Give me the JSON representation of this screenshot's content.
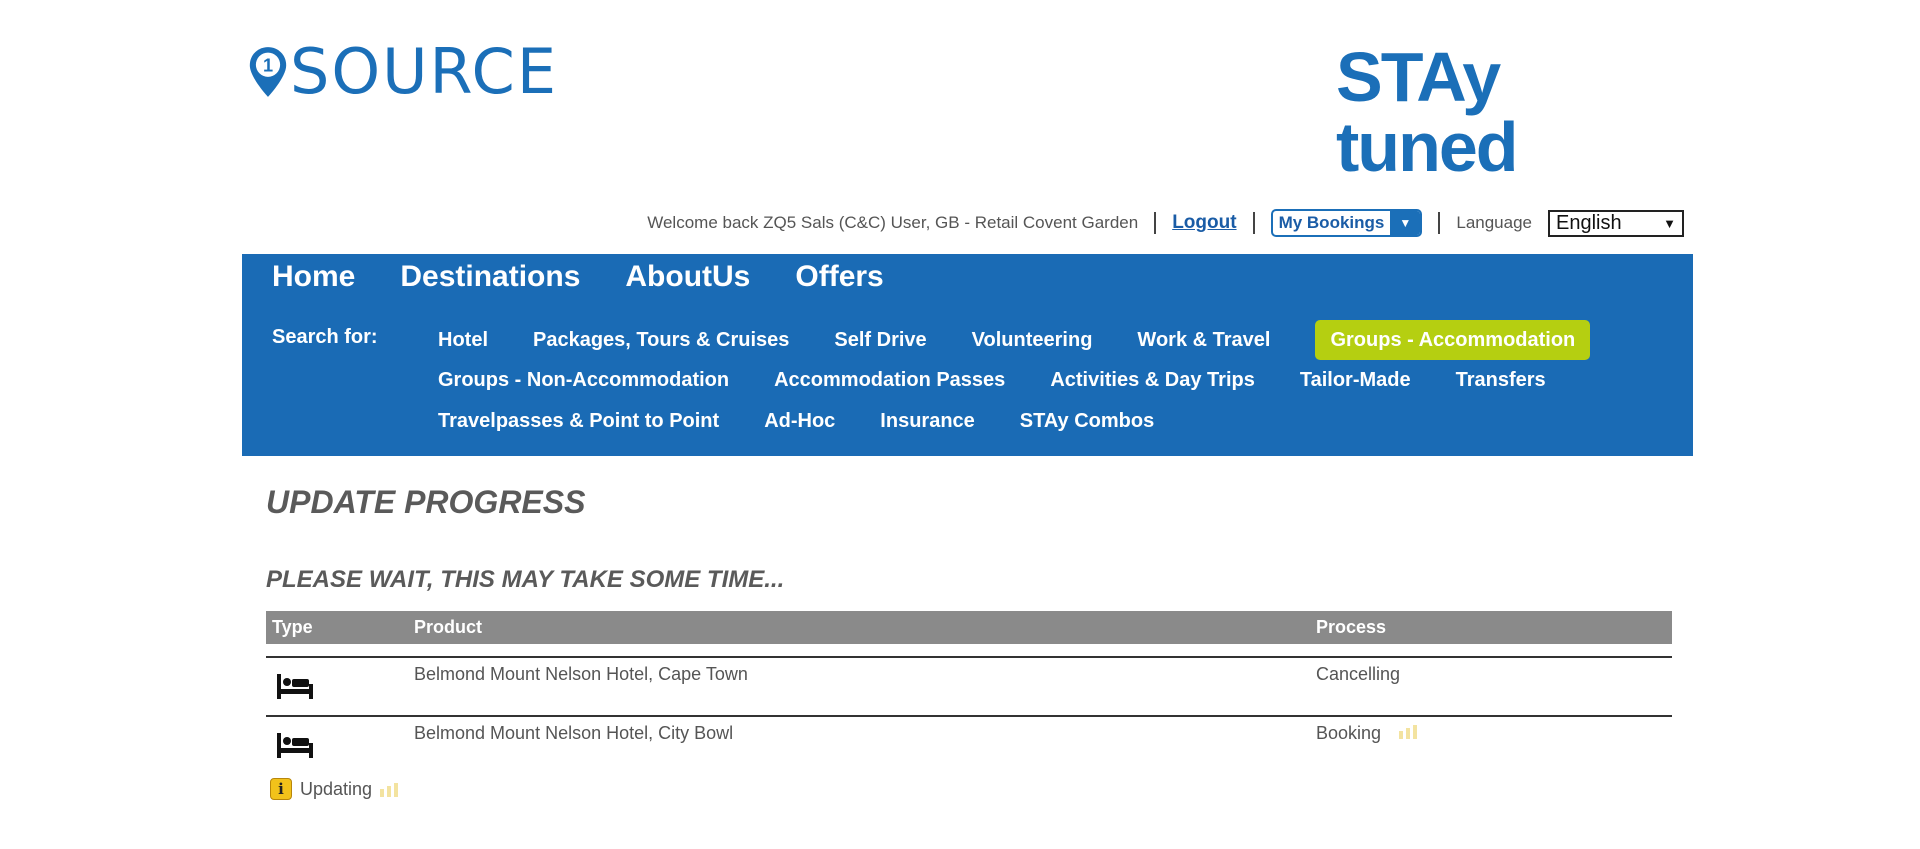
{
  "header": {
    "left_logo_text": "SOURCE",
    "right_logo_text": "STAy tuned"
  },
  "userbar": {
    "welcome": "Welcome back ZQ5 Sals (C&C) User, GB - Retail Covent Garden",
    "logout": "Logout",
    "my_bookings": "My Bookings",
    "language_label": "Language",
    "language_value": "English"
  },
  "nav": {
    "main": [
      "Home",
      "Destinations",
      "AboutUs",
      "Offers"
    ],
    "search_for_label": "Search for:",
    "row1": [
      "Hotel",
      "Packages, Tours & Cruises",
      "Self Drive",
      "Volunteering",
      "Work & Travel",
      "Groups - Accommodation"
    ],
    "row2": [
      "Groups - Non-Accommodation",
      "Accommodation Passes",
      "Activities & Day Trips",
      "Tailor-Made",
      "Transfers"
    ],
    "row3": [
      "Travelpasses & Point to Point",
      "Ad-Hoc",
      "Insurance",
      "STAy Combos"
    ],
    "active_item": "Groups - Accommodation",
    "colors": {
      "panel": "#1a6bb5",
      "active": "#b5cf11"
    }
  },
  "progress": {
    "title": "UPDATE PROGRESS",
    "subtitle": "PLEASE WAIT, THIS MAY TAKE SOME TIME...",
    "columns": [
      "Type",
      "Product",
      "Process"
    ],
    "rows": [
      {
        "type_icon": "bed-icon",
        "product": "Belmond Mount Nelson Hotel, Cape Town",
        "process": "Cancelling"
      },
      {
        "type_icon": "bed-icon",
        "product": "Belmond Mount Nelson Hotel, City Bowl",
        "process": "Booking"
      }
    ],
    "status": "Updating"
  }
}
